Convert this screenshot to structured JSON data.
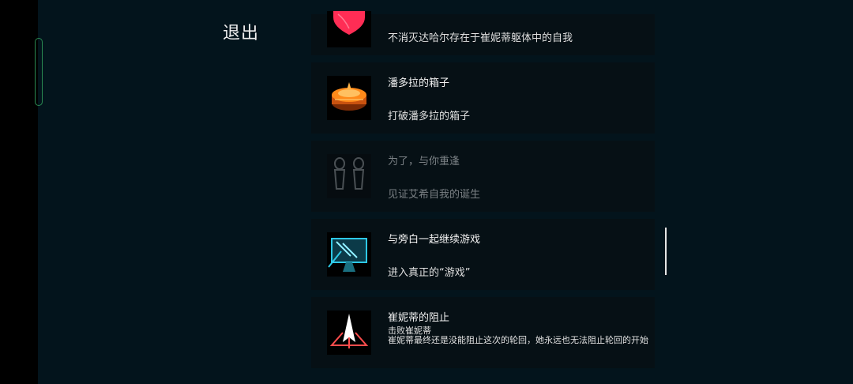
{
  "header": {
    "exit_label": "退出"
  },
  "achievements": [
    {
      "title": "",
      "desc": "不消灭达哈尔存在于崔妮蒂躯体中的自我",
      "icon": "heart-icon",
      "locked": false
    },
    {
      "title": "潘多拉的箱子",
      "desc": "打破潘多拉的箱子",
      "icon": "box-icon",
      "locked": false
    },
    {
      "title": "为了，与你重逢",
      "desc": "见证艾希自我的诞生",
      "icon": "twins-icon",
      "locked": true
    },
    {
      "title": "与旁白一起继续游戏",
      "desc": "进入真正的“游戏”",
      "icon": "monitor-icon",
      "locked": false
    },
    {
      "title": "崔妮蒂的阻止",
      "desc_line1": "击败崔妮蒂",
      "desc_line2": "崔妮蒂最终还是没能阻止这次的轮回，她永远也无法阻止轮回的开始",
      "icon": "ship-icon",
      "locked": false
    }
  ],
  "colors": {
    "background": "#03141c",
    "card": "#061015",
    "accent_heart": "#ff2d55",
    "accent_box": "#ff8a1a",
    "accent_monitor": "#2ec8e6"
  }
}
